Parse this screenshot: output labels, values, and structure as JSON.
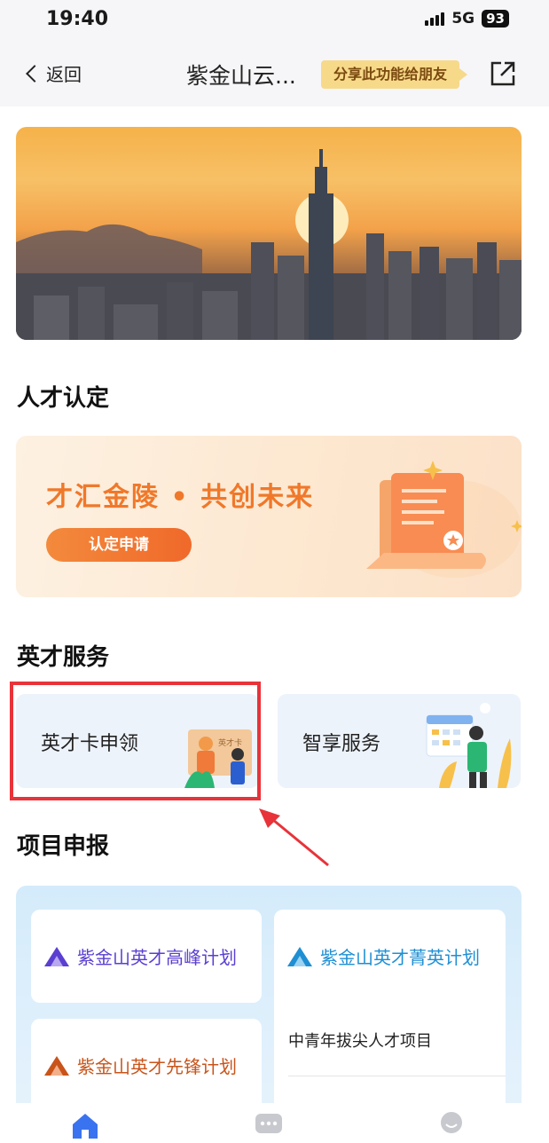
{
  "status_bar": {
    "time": "19:40",
    "network": "5G",
    "battery": "93"
  },
  "nav": {
    "back_label": "返回",
    "title": "紫金山云...",
    "share_tip": "分享此功能给朋友"
  },
  "sections": {
    "talent_title": "人才认定",
    "services_title": "英才服务",
    "projects_title": "项目申报"
  },
  "talent_banner": {
    "slogan": "才汇金陵 • 共创未来",
    "apply_button": "认定申请"
  },
  "services": [
    {
      "label": "英才卡申领",
      "illustration_card_text": "英才卡"
    },
    {
      "label": "智享服务"
    }
  ],
  "projects": [
    {
      "label": "紫金山英才高峰计划",
      "color": "#5b3fd1"
    },
    {
      "label": "紫金山英才菁英计划",
      "color": "#1f8fd3",
      "sub": "中青年拔尖人才项目"
    },
    {
      "label": "紫金山英才先锋计划",
      "color": "#c9541a"
    }
  ],
  "tabs": [
    {
      "icon": "home-icon",
      "active": true
    },
    {
      "icon": "chat-icon",
      "active": false
    },
    {
      "icon": "profile-icon",
      "active": false
    }
  ],
  "colors": {
    "accent_orange": "#f0692a",
    "highlight_red": "#e8333a",
    "active_tab": "#3a73f0"
  }
}
